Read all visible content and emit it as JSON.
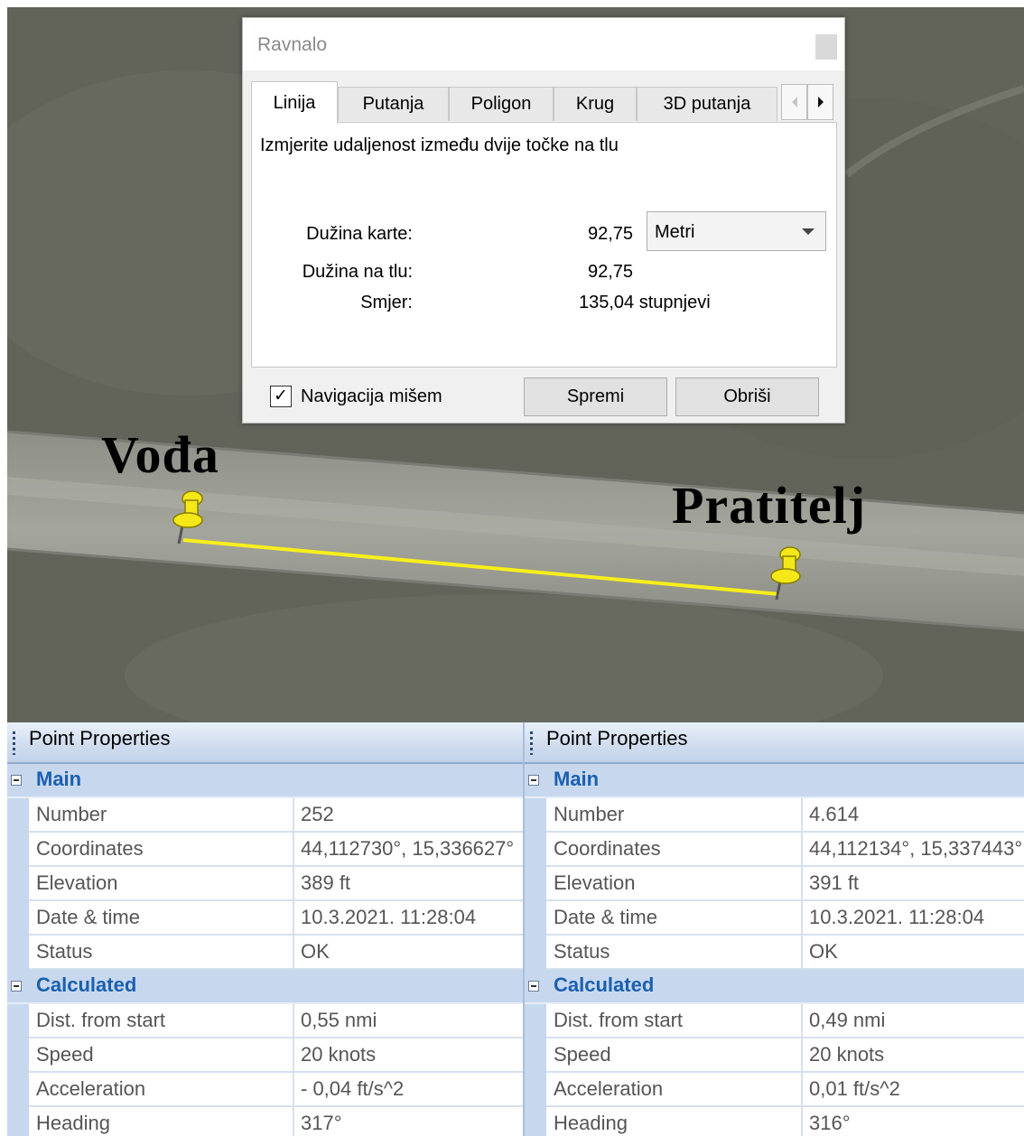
{
  "map": {
    "leader_label": "Vođa",
    "follower_label": "Pratitelj",
    "pin_color": "#f2e600",
    "track_color": "#f7ef1a"
  },
  "dialog": {
    "title": "Ravnalo",
    "tabs": [
      "Linija",
      "Putanja",
      "Poligon",
      "Krug",
      "3D putanja"
    ],
    "active_tab": "Linija",
    "description": "Izmjerite udaljenost između dvije točke na tlu",
    "map_length_label": "Dužina karte:",
    "map_length_value": "92,75",
    "unit_selected": "Metri",
    "ground_length_label": "Dužina na tlu:",
    "ground_length_value": "92,75",
    "heading_label": "Smjer:",
    "heading_value": "135,04 stupnjevi",
    "mouse_nav_checked": true,
    "mouse_nav_label": "Navigacija mišem",
    "save_label": "Spremi",
    "clear_label": "Obriši"
  },
  "panels": [
    {
      "title": "Point Properties",
      "main_label": "Main",
      "calculated_label": "Calculated",
      "main": [
        {
          "name": "Number",
          "value": "252"
        },
        {
          "name": "Coordinates",
          "value": "44,112730°, 15,336627°"
        },
        {
          "name": "Elevation",
          "value": "389 ft"
        },
        {
          "name": "Date & time",
          "value": "10.3.2021. 11:28:04"
        },
        {
          "name": "Status",
          "value": "OK"
        }
      ],
      "calculated": [
        {
          "name": "Dist. from start",
          "value": "0,55 nmi"
        },
        {
          "name": "Speed",
          "value": "20 knots"
        },
        {
          "name": "Acceleration",
          "value": "- 0,04 ft/s^2"
        },
        {
          "name": "Heading",
          "value": "317°"
        }
      ]
    },
    {
      "title": "Point Properties",
      "main_label": "Main",
      "calculated_label": "Calculated",
      "main": [
        {
          "name": "Number",
          "value": "4.614"
        },
        {
          "name": "Coordinates",
          "value": "44,112134°, 15,337443°"
        },
        {
          "name": "Elevation",
          "value": "391 ft"
        },
        {
          "name": "Date & time",
          "value": "10.3.2021. 11:28:04"
        },
        {
          "name": "Status",
          "value": "OK"
        }
      ],
      "calculated": [
        {
          "name": "Dist. from start",
          "value": "0,49 nmi"
        },
        {
          "name": "Speed",
          "value": "20 knots"
        },
        {
          "name": "Acceleration",
          "value": "0,01 ft/s^2"
        },
        {
          "name": "Heading",
          "value": "316°"
        }
      ]
    }
  ]
}
